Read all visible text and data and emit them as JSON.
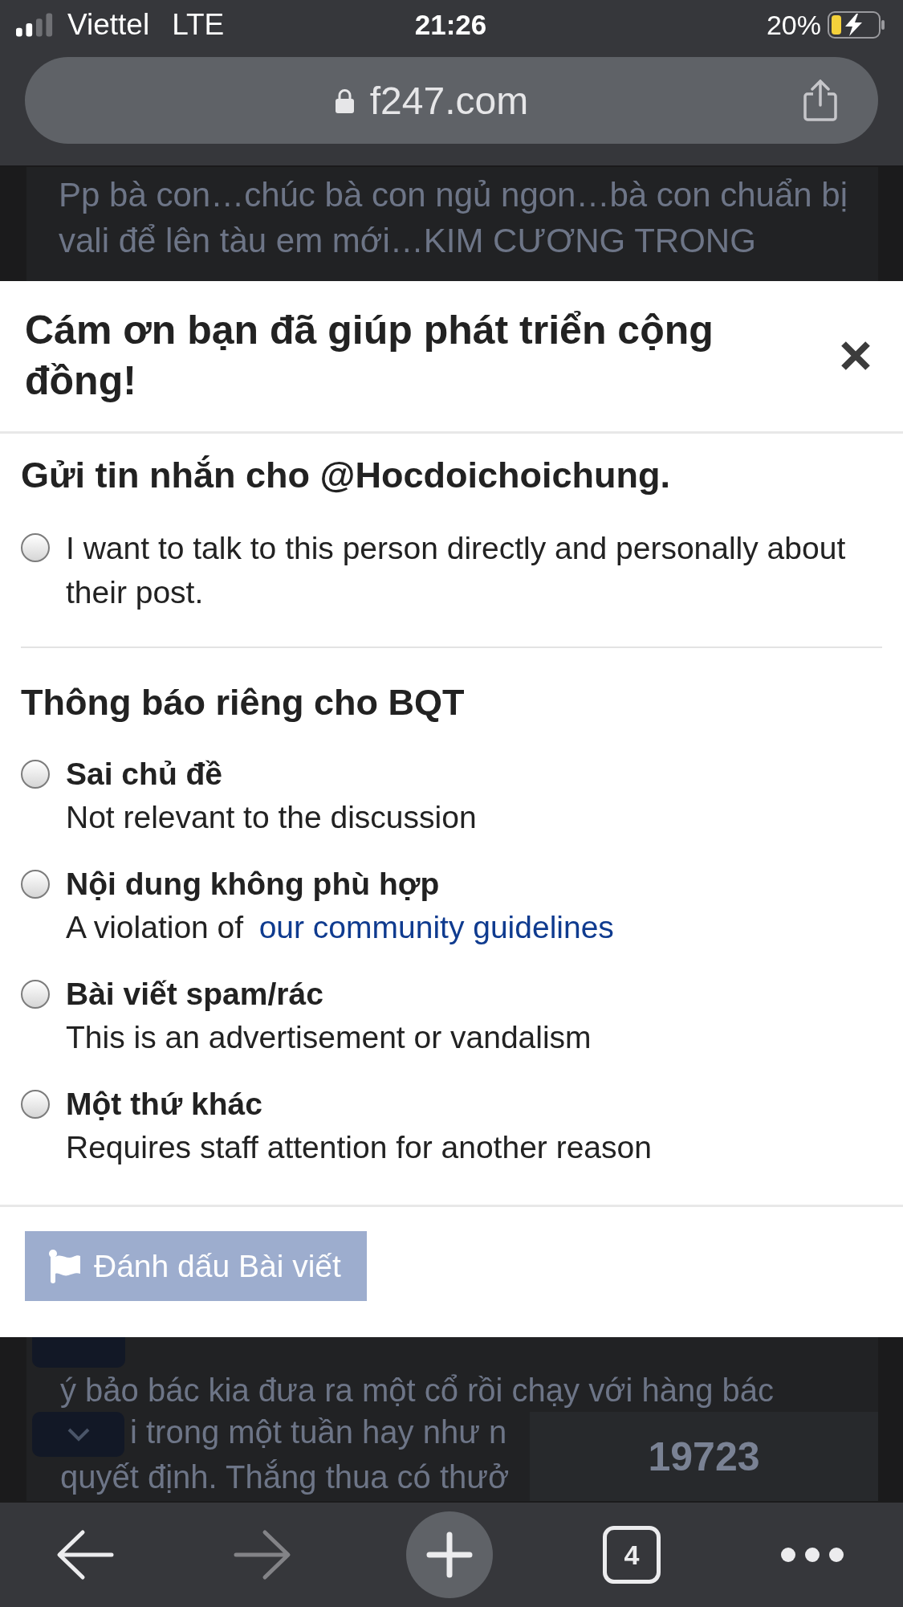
{
  "status_bar": {
    "carrier": "Viettel",
    "network": "LTE",
    "time": "21:26",
    "battery": "20%"
  },
  "address_bar": {
    "url": "f247.com"
  },
  "page_behind": {
    "lines_above": [
      "Pp bà con…chúc bà con ngủ ngon…bà con chuẩn bị",
      "vali để lên tàu em mới…KIM CƯƠNG TRONG"
    ],
    "lines_below": [
      "ý bảo bác kia đưa ra một cổ rồi chạy với hàng bác",
      "i trong một tuần hay như n",
      "quyết định. Thắng thua có thưở"
    ],
    "counter": "19723"
  },
  "dialog": {
    "title": "Cám ơn bạn đã giúp phát triển cộng đồng!",
    "sections": [
      {
        "heading": "Gửi tin nhắn cho @Hocdoichoichung.",
        "options": [
          {
            "kind": "plain",
            "label": "I want to talk to this person directly and personally about their post.",
            "selected": false
          }
        ]
      },
      {
        "heading": "Thông báo riêng cho BQT",
        "options": [
          {
            "kind": "titled",
            "title": "Sai chủ đề",
            "description": "Not relevant to the discussion",
            "selected": false
          },
          {
            "kind": "titled",
            "title": "Nội dung không phù hợp",
            "description": "A violation of",
            "link": "our community guidelines",
            "selected": false
          },
          {
            "kind": "titled",
            "title": "Bài viết spam/rác",
            "description": "This is an advertisement or vandalism",
            "selected": false
          },
          {
            "kind": "titled",
            "title": "Một thứ khác",
            "description": "Requires staff attention for another reason",
            "selected": false
          }
        ]
      }
    ],
    "submit_button": {
      "label": "Đánh dấu Bài viết",
      "disabled": true
    }
  },
  "toolbar": [
    {
      "kind": "back",
      "disabled": false
    },
    {
      "kind": "forward",
      "disabled": true
    },
    {
      "kind": "new_tab"
    },
    {
      "kind": "tabs",
      "label": "4"
    },
    {
      "kind": "more"
    }
  ]
}
